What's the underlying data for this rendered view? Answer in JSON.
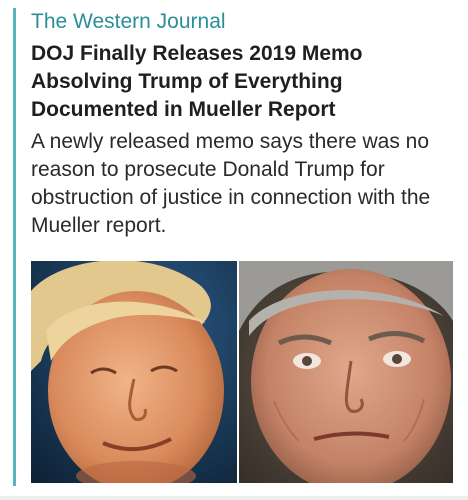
{
  "article": {
    "publisher": "The Western Journal",
    "headline": "DOJ Finally Releases 2019 Memo Absolving Trump of Everything Documented in Mueller Report",
    "summary": "A newly released memo says there was no reason to prosecute Donald Trump for obstruction of justice in connection with the Mueller report."
  },
  "colors": {
    "accent": "#57b4b8",
    "publisher": "#2a8f99",
    "headline": "#1f1f1f",
    "body_text": "#2a2a2a"
  }
}
